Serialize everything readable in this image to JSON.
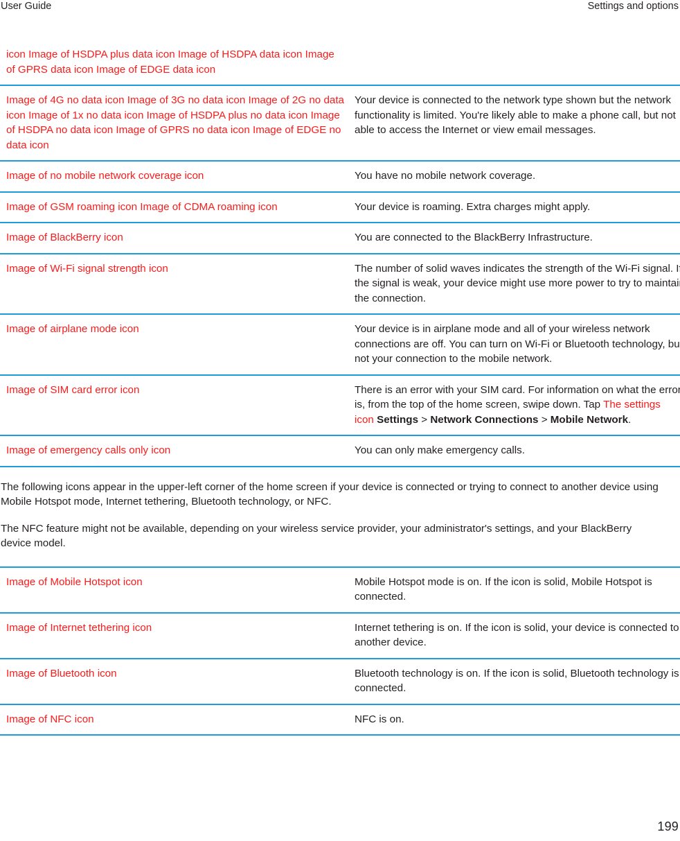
{
  "header": {
    "left": "User Guide",
    "right": "Settings and options"
  },
  "table_top": {
    "rows": [
      {
        "continued_from_previous_page": true,
        "icon": "icon  Image of HSDPA plus data icon  Image of HSDPA data icon  Image of GPRS data icon  Image of EDGE data icon",
        "description": ""
      },
      {
        "icon": " Image of 4G no data icon  Image of 3G no data icon  Image of 2G no data icon  Image of 1x no data icon  Image of HSDPA plus no data icon  Image of HSDPA no data icon  Image of GPRS no data icon  Image of EDGE no data icon",
        "description": "Your device is connected to the network type shown but the network functionality is limited. You're likely able to make a phone call, but not able to access the Internet or view email messages."
      },
      {
        "icon": "Image of no mobile network coverage icon",
        "description": "You have no mobile network coverage."
      },
      {
        "icon": "Image of GSM roaming icon  Image of CDMA roaming icon",
        "description": "Your device is roaming. Extra charges might apply."
      },
      {
        "icon": "Image of BlackBerry icon",
        "description": "You are connected to the BlackBerry Infrastructure."
      },
      {
        "icon": "Image of Wi-Fi signal strength icon",
        "description": "The number of solid waves indicates the strength of the Wi-Fi signal. If the signal is weak, your device might use more power to try to maintain the connection."
      },
      {
        "icon": "Image of airplane mode icon",
        "description": "Your device is in airplane mode and all of your wireless network connections are off. You can turn on Wi-Fi or Bluetooth technology, but not your connection to the mobile network."
      },
      {
        "icon": "Image of SIM card error icon",
        "description_rich": {
          "lead": "There is an error with your SIM card. For information on what the error is, from the top of the home screen, swipe down. Tap ",
          "settings_icon_text": "The settings icon",
          "path_1": "Settings",
          "sep_1": " > ",
          "path_2": "Network Connections",
          "sep_2": " > ",
          "path_3": "Mobile Network",
          "tail": "."
        }
      },
      {
        "icon": "Image of emergency calls only icon",
        "description": "You can only make emergency calls."
      }
    ]
  },
  "paragraphs": [
    "The following icons appear in the upper-left corner of the home screen if your device is connected or trying to connect to another device using Mobile Hotspot mode, Internet tethering, Bluetooth technology, or NFC.",
    "The NFC feature might not be available, depending on your wireless service provider, your administrator's settings, and your BlackBerry device model."
  ],
  "table_bottom": {
    "rows": [
      {
        "icon": "Image of Mobile Hotspot icon",
        "description": "Mobile Hotspot mode is on. If the icon is solid, Mobile Hotspot is connected."
      },
      {
        "icon": "Image of Internet tethering icon",
        "description": "Internet tethering is on. If the icon is solid, your device is connected to another device."
      },
      {
        "icon": "Image of Bluetooth icon",
        "description": "Bluetooth technology is on. If the icon is solid, Bluetooth technology is connected."
      },
      {
        "icon": "Image of NFC icon",
        "description": "NFC is on."
      }
    ]
  },
  "footer": {
    "page_number": "199"
  },
  "colors": {
    "rule": "#1b9dd9",
    "icon_text": "#fb1b1b",
    "body_text": "#231f20"
  }
}
